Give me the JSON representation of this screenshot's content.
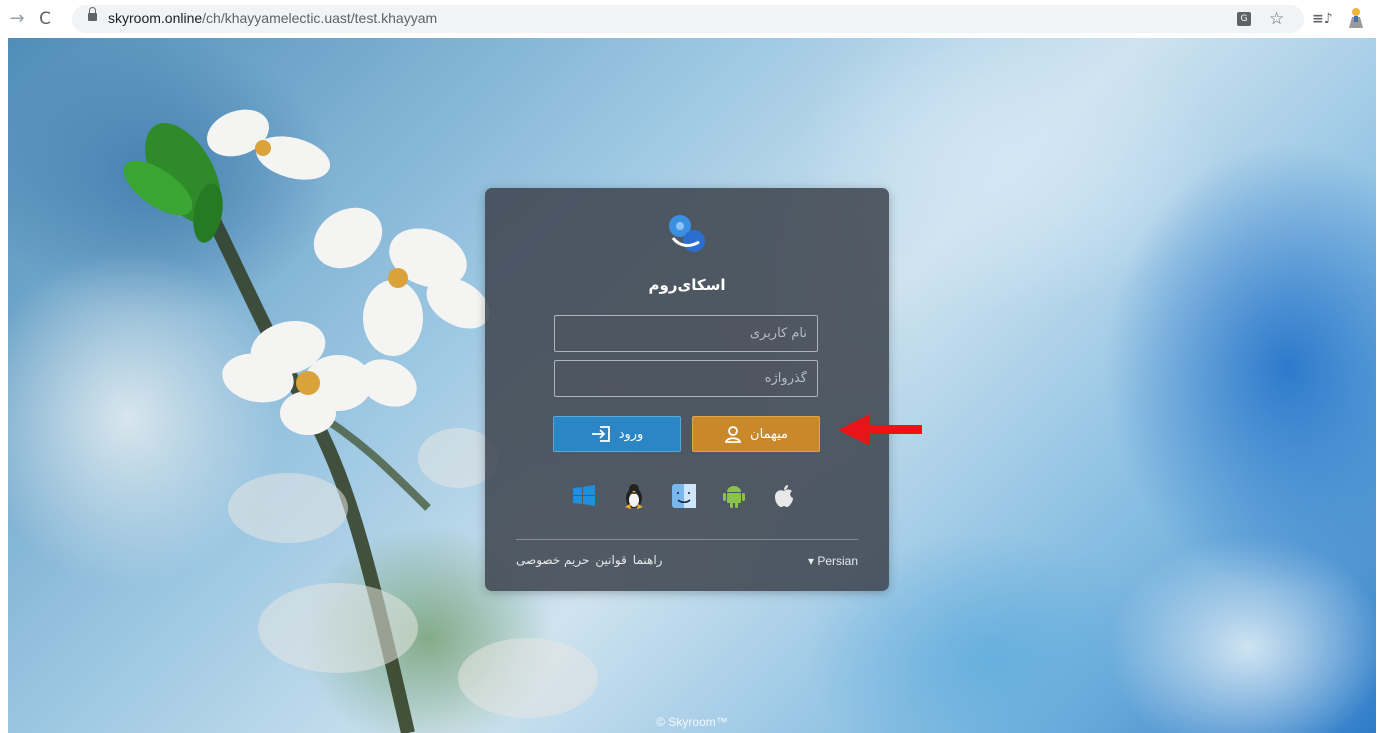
{
  "browser": {
    "url_host": "skyroom.online",
    "url_path": "/ch/khayyamelectic.uast/test.khayyam"
  },
  "login": {
    "title": "اسکای‌روم",
    "username_placeholder": "نام کاربری",
    "password_placeholder": "گذرواژه",
    "login_label": "ورود",
    "guest_label": "میهمان",
    "language_label": "Persian",
    "footer_links": [
      "راهنما",
      "قوانین",
      "حریم خصوصی"
    ]
  },
  "footer": {
    "copyright": "© Skyroom™"
  },
  "colors": {
    "panel": "#3a404a",
    "guest_button": "#c9892a",
    "login_button": "#2a86c4",
    "annotation_arrow": "#e8141a"
  },
  "icons": {
    "platforms": [
      "windows-icon",
      "linux-icon",
      "macos-finder-icon",
      "android-icon",
      "apple-icon"
    ]
  }
}
